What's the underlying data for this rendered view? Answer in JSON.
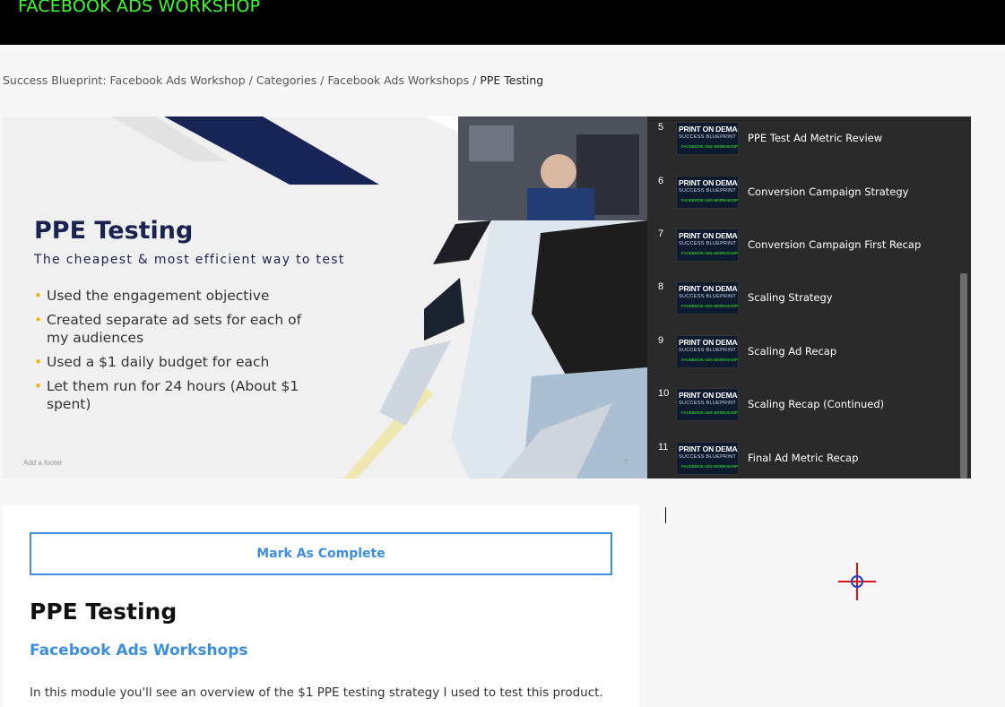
{
  "header": {
    "brand": "FACEBOOK ADS WORKSHOP"
  },
  "breadcrumb": [
    {
      "label": "Success Blueprint: Facebook Ads Workshop"
    },
    {
      "label": "Categories"
    },
    {
      "label": "Facebook Ads Workshops"
    },
    {
      "label": "PPE Testing",
      "current": true
    }
  ],
  "slide": {
    "title": "PPE Testing",
    "subtitle": "The cheapest & most efficient way to test",
    "bullets": [
      "Used the engagement objective",
      "Created separate ad sets for each of my audiences",
      "Used a $1 daily budget for each",
      "Let them run for 24 hours (About $1 spent)"
    ],
    "footer": "Add a footer",
    "page": "7"
  },
  "playlist": {
    "thumb_line1": "PRINT ON DEMAND",
    "thumb_line2": "SUCCESS BLUEPRINT",
    "thumb_line3": "FACEBOOK ADS WORKSHOP",
    "items": [
      {
        "num": "5",
        "label": "PPE Test Ad Metric Review"
      },
      {
        "num": "6",
        "label": "Conversion Campaign Strategy"
      },
      {
        "num": "7",
        "label": "Conversion Campaign First Recap"
      },
      {
        "num": "8",
        "label": "Scaling Strategy"
      },
      {
        "num": "9",
        "label": "Scaling Ad Recap"
      },
      {
        "num": "10",
        "label": "Scaling Recap (Continued)"
      },
      {
        "num": "11",
        "label": "Final Ad Metric Recap"
      }
    ]
  },
  "lesson": {
    "complete_label": "Mark As Complete",
    "title": "PPE Testing",
    "category": "Facebook Ads Workshops",
    "description": "In this module you'll see an overview of the $1 PPE testing strategy I used to test this product."
  },
  "colors": {
    "brand_green": "#3aff2d",
    "accent_blue": "#3d8ee0",
    "slide_navy": "#1a2450",
    "bullet_gold": "#f0b400"
  }
}
